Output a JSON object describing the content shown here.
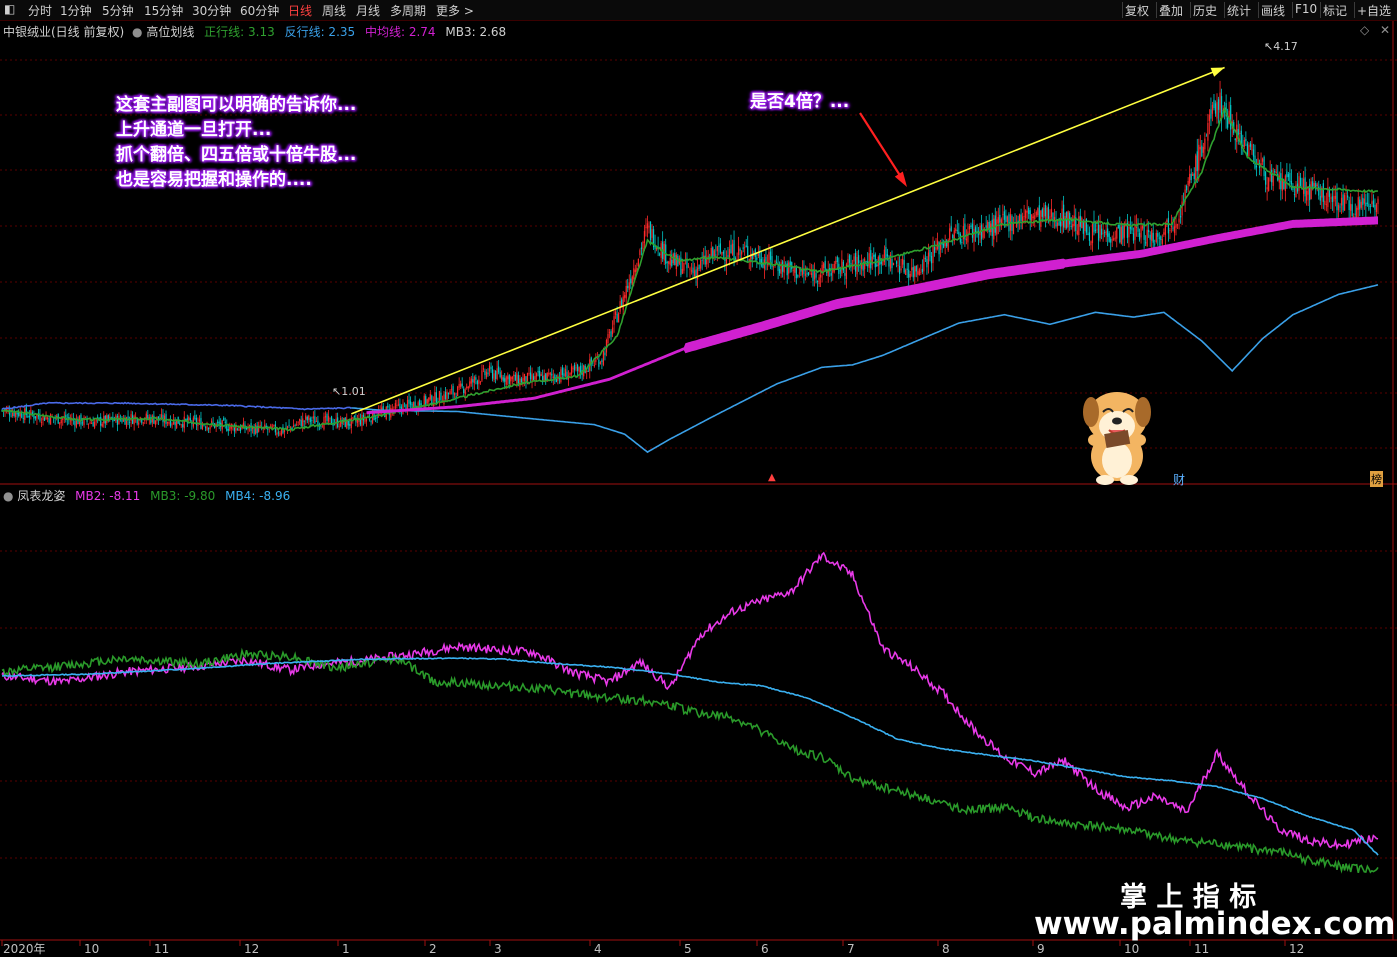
{
  "toolbar": {
    "periods": [
      "分时",
      "1分钟",
      "5分钟",
      "15分钟",
      "30分钟",
      "60分钟",
      "日线",
      "周线",
      "月线",
      "多周期",
      "更多 >"
    ],
    "active_period": "日线",
    "right_buttons": [
      "复权",
      "叠加",
      "历史",
      "统计",
      "画线",
      "F10",
      "标记",
      "+自选"
    ]
  },
  "main_header": {
    "stock": "中银绒业(日线 前复权)",
    "indicator": "高位划线",
    "zheng_label": "正行线: 3.13",
    "fan_label": "反行线: 2.35",
    "mid_label": "中均线: 2.74",
    "mb3_label": "MB3: 2.68"
  },
  "sub_header": {
    "indicator": "凤表龙姿",
    "mb2_label": "MB2: -8.11",
    "mb3_label": "MB3: -9.80",
    "mb4_label": "MB4: -8.96"
  },
  "annotations": {
    "lines": [
      "这套主副图可以明确的告诉你...",
      "上升通道一旦打开...",
      "抓个翻倍、四五倍或十倍牛股...",
      "也是容易把握和操作的...."
    ],
    "question": "是否4倍？..."
  },
  "markers": {
    "high": "4.17",
    "low": "1.01",
    "cai": "财",
    "bang": "榜"
  },
  "watermark": {
    "cn": "掌 上 指 标",
    "url": "www.palmindex.com"
  },
  "colors": {
    "up": "#ff2a2a",
    "down": "#00c8c8",
    "zheng": "#2fa02f",
    "fan": "#3aa0e8",
    "mid": "#d020d0",
    "mb2": "#e83ae8",
    "mb3": "#2a9a2a",
    "mb4": "#3ab0f0",
    "trend": "#ffff40",
    "arrow": "#ff2020"
  },
  "chart_data": [
    {
      "type": "candlestick+line",
      "x_labels": [
        "2020年",
        "10",
        "11",
        "12",
        "1",
        "2",
        "3",
        "4",
        "5",
        "6",
        "7",
        "8",
        "9",
        "10",
        "11",
        "12"
      ],
      "y_range": [
        0.8,
        4.4
      ],
      "candles_close_profile": [
        [
          0,
          1.3
        ],
        [
          30,
          1.24
        ],
        [
          60,
          1.2
        ],
        [
          90,
          1.24
        ],
        [
          130,
          1.19
        ],
        [
          160,
          1.15
        ],
        [
          185,
          1.13
        ],
        [
          200,
          1.22
        ],
        [
          230,
          1.19
        ],
        [
          255,
          1.3
        ],
        [
          275,
          1.36
        ],
        [
          300,
          1.46
        ],
        [
          320,
          1.62
        ],
        [
          340,
          1.55
        ],
        [
          360,
          1.58
        ],
        [
          380,
          1.62
        ],
        [
          395,
          1.74
        ],
        [
          410,
          2.28
        ],
        [
          425,
          2.82
        ],
        [
          440,
          2.55
        ],
        [
          455,
          2.46
        ],
        [
          470,
          2.62
        ],
        [
          490,
          2.63
        ],
        [
          510,
          2.52
        ],
        [
          530,
          2.43
        ],
        [
          555,
          2.5
        ],
        [
          580,
          2.58
        ],
        [
          600,
          2.46
        ],
        [
          625,
          2.77
        ],
        [
          650,
          2.82
        ],
        [
          675,
          2.93
        ],
        [
          700,
          2.91
        ],
        [
          720,
          2.77
        ],
        [
          745,
          2.8
        ],
        [
          760,
          2.76
        ],
        [
          775,
          2.95
        ],
        [
          790,
          3.5
        ],
        [
          800,
          3.9
        ],
        [
          815,
          3.6
        ],
        [
          835,
          3.22
        ],
        [
          855,
          3.17
        ],
        [
          875,
          3.07
        ],
        [
          890,
          3.01
        ],
        [
          906,
          3.06
        ]
      ],
      "zheng_line": [
        [
          0,
          1.3
        ],
        [
          50,
          1.22
        ],
        [
          100,
          1.23
        ],
        [
          160,
          1.16
        ],
        [
          190,
          1.14
        ],
        [
          250,
          1.26
        ],
        [
          300,
          1.4
        ],
        [
          340,
          1.52
        ],
        [
          380,
          1.59
        ],
        [
          405,
          1.92
        ],
        [
          425,
          2.72
        ],
        [
          445,
          2.55
        ],
        [
          470,
          2.58
        ],
        [
          510,
          2.52
        ],
        [
          540,
          2.46
        ],
        [
          580,
          2.56
        ],
        [
          620,
          2.7
        ],
        [
          660,
          2.86
        ],
        [
          700,
          2.9
        ],
        [
          740,
          2.85
        ],
        [
          770,
          2.86
        ],
        [
          790,
          3.3
        ],
        [
          805,
          3.82
        ],
        [
          820,
          3.42
        ],
        [
          850,
          3.17
        ],
        [
          906,
          3.13
        ]
      ],
      "fan_line": [
        [
          0,
          1.31
        ],
        [
          30,
          1.36
        ],
        [
          80,
          1.36
        ],
        [
          150,
          1.34
        ],
        [
          200,
          1.31
        ],
        [
          230,
          1.32
        ],
        [
          250,
          1.3
        ],
        [
          300,
          1.29
        ],
        [
          340,
          1.24
        ],
        [
          390,
          1.18
        ],
        [
          410,
          1.1
        ],
        [
          425,
          0.95
        ],
        [
          440,
          1.06
        ],
        [
          470,
          1.26
        ],
        [
          510,
          1.52
        ],
        [
          540,
          1.66
        ],
        [
          560,
          1.68
        ],
        [
          580,
          1.76
        ],
        [
          630,
          2.03
        ],
        [
          660,
          2.1
        ],
        [
          690,
          2.02
        ],
        [
          720,
          2.12
        ],
        [
          745,
          2.08
        ],
        [
          765,
          2.12
        ],
        [
          790,
          1.88
        ],
        [
          810,
          1.63
        ],
        [
          830,
          1.9
        ],
        [
          850,
          2.1
        ],
        [
          880,
          2.27
        ],
        [
          906,
          2.35
        ]
      ],
      "mid_band": [
        [
          240,
          1.28
        ],
        [
          300,
          1.33
        ],
        [
          350,
          1.4
        ],
        [
          400,
          1.56
        ],
        [
          450,
          1.82
        ],
        [
          500,
          2.0
        ],
        [
          550,
          2.19
        ],
        [
          600,
          2.31
        ],
        [
          650,
          2.44
        ],
        [
          700,
          2.53
        ],
        [
          750,
          2.61
        ],
        [
          800,
          2.74
        ],
        [
          850,
          2.86
        ],
        [
          906,
          2.89
        ]
      ],
      "trend_line": [
        [
          230,
          1.27
        ],
        [
          805,
          4.17
        ]
      ],
      "high": 4.17,
      "low": 1.01
    },
    {
      "type": "line",
      "series": [
        {
          "name": "MB2",
          "values": [
            [
              0,
              0.1
            ],
            [
              40,
              -0.2
            ],
            [
              80,
              0.3
            ],
            [
              130,
              0.6
            ],
            [
              160,
              0.9
            ],
            [
              190,
              0.4
            ],
            [
              210,
              0.7
            ],
            [
              240,
              0.9
            ],
            [
              270,
              1.2
            ],
            [
              300,
              1.6
            ],
            [
              330,
              1.4
            ],
            [
              350,
              1.3
            ],
            [
              375,
              0.3
            ],
            [
              400,
              -0.2
            ],
            [
              420,
              0.8
            ],
            [
              440,
              -0.5
            ],
            [
              460,
              2.2
            ],
            [
              482,
              3.4
            ],
            [
              500,
              3.9
            ],
            [
              520,
              4.4
            ],
            [
              540,
              6.2
            ],
            [
              560,
              5.2
            ],
            [
              580,
              1.5
            ],
            [
              600,
              0.5
            ],
            [
              620,
              -0.8
            ],
            [
              640,
              -2.6
            ],
            [
              660,
              -4.0
            ],
            [
              680,
              -4.8
            ],
            [
              700,
              -4.2
            ],
            [
              720,
              -5.6
            ],
            [
              740,
              -6.6
            ],
            [
              760,
              -6.0
            ],
            [
              780,
              -6.8
            ],
            [
              800,
              -3.8
            ],
            [
              820,
              -5.8
            ],
            [
              840,
              -7.6
            ],
            [
              860,
              -8.2
            ],
            [
              880,
              -8.5
            ],
            [
              895,
              -8.2
            ],
            [
              906,
              -8.1
            ]
          ]
        },
        {
          "name": "MB3",
          "values": [
            [
              0,
              0.3
            ],
            [
              40,
              0.6
            ],
            [
              80,
              1.0
            ],
            [
              130,
              0.7
            ],
            [
              160,
              1.2
            ],
            [
              190,
              1.1
            ],
            [
              220,
              0.5
            ],
            [
              260,
              1.0
            ],
            [
              285,
              -0.2
            ],
            [
              330,
              -0.4
            ],
            [
              360,
              -0.6
            ],
            [
              375,
              -0.8
            ],
            [
              400,
              -1.0
            ],
            [
              430,
              -1.2
            ],
            [
              460,
              -1.8
            ],
            [
              480,
              -2.0
            ],
            [
              500,
              -2.7
            ],
            [
              520,
              -3.6
            ],
            [
              540,
              -4.0
            ],
            [
              560,
              -5.1
            ],
            [
              580,
              -5.5
            ],
            [
              600,
              -5.9
            ],
            [
              620,
              -6.4
            ],
            [
              640,
              -6.7
            ],
            [
              660,
              -6.5
            ],
            [
              680,
              -7.1
            ],
            [
              700,
              -7.4
            ],
            [
              720,
              -7.5
            ],
            [
              740,
              -7.7
            ],
            [
              760,
              -8.0
            ],
            [
              780,
              -8.3
            ],
            [
              800,
              -8.4
            ],
            [
              820,
              -8.6
            ],
            [
              840,
              -8.8
            ],
            [
              860,
              -9.2
            ],
            [
              880,
              -9.5
            ],
            [
              906,
              -9.8
            ]
          ]
        },
        {
          "name": "MB4",
          "values": [
            [
              0,
              0.1
            ],
            [
              60,
              0.2
            ],
            [
              120,
              0.45
            ],
            [
              180,
              0.75
            ],
            [
              240,
              0.95
            ],
            [
              300,
              1.0
            ],
            [
              330,
              0.95
            ],
            [
              360,
              0.75
            ],
            [
              400,
              0.55
            ],
            [
              440,
              0.2
            ],
            [
              470,
              -0.2
            ],
            [
              500,
              -0.4
            ],
            [
              530,
              -1.0
            ],
            [
              560,
              -2.0
            ],
            [
              590,
              -3.1
            ],
            [
              620,
              -3.6
            ],
            [
              650,
              -3.9
            ],
            [
              680,
              -4.2
            ],
            [
              710,
              -4.6
            ],
            [
              740,
              -5.0
            ],
            [
              770,
              -5.2
            ],
            [
              800,
              -5.5
            ],
            [
              830,
              -6.1
            ],
            [
              860,
              -7.0
            ],
            [
              890,
              -7.7
            ],
            [
              906,
              -8.96
            ]
          ]
        }
      ],
      "y_range": [
        -13,
        9
      ]
    }
  ]
}
